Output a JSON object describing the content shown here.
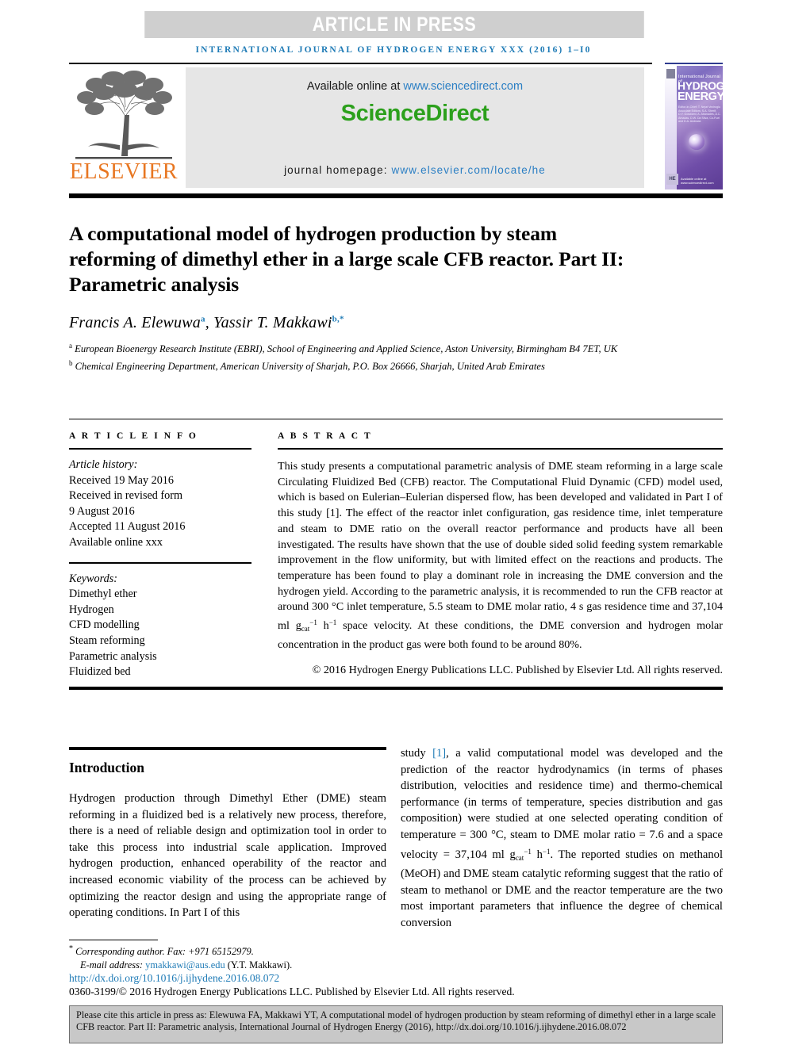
{
  "banner": {
    "text": "ARTICLE IN PRESS",
    "bg_color": "#cfcfcf",
    "text_color": "#ffffff"
  },
  "running_head": "INTERNATIONAL JOURNAL OF HYDROGEN ENERGY XXX (2016) 1–I0",
  "masthead": {
    "publisher": "ELSEVIER",
    "publisher_color": "#e87722",
    "available_prefix": "Available online at ",
    "available_url": "www.sciencedirect.com",
    "sciencedirect_logo": "ScienceDirect",
    "sciencedirect_color": "#2ca01c",
    "homepage_prefix": "journal homepage: ",
    "homepage_url": "www.elsevier.com/locate/he",
    "link_color": "#2b7fc4"
  },
  "cover": {
    "line_italic": "International Journal of",
    "line1": "HYDROGEN",
    "line2": "ENERGY",
    "editors": "Editor-in-Chief: T. Nejat Veziroglu\nAssociate Editors: S.A. Sherif, D.Y. Goswami, A. Abanades,\nA.C. Amadas, D.W. Da Silva,\nCo-Fuel and D.A. Andrada",
    "he_mark": "HE",
    "sd_mark": "Available online at www.sciencedirect.com"
  },
  "title": "A computational model of hydrogen production by steam reforming of dimethyl ether in a large scale CFB reactor. Part II: Parametric analysis",
  "authors": [
    {
      "name": "Francis A. Elewuwa",
      "marks": "a"
    },
    {
      "name": "Yassir T. Makkawi",
      "marks": "b,*"
    }
  ],
  "affiliations": [
    {
      "mark": "a",
      "text": "European Bioenergy Research Institute (EBRI), School of Engineering and Applied Science, Aston University, Birmingham B4 7ET, UK"
    },
    {
      "mark": "b",
      "text": "Chemical Engineering Department, American University of Sharjah, P.O. Box 26666, Sharjah, United Arab Emirates"
    }
  ],
  "article_info": {
    "heading": "A R T I C L E   I N F O",
    "history_label": "Article history:",
    "history": [
      "Received 19 May 2016",
      "Received in revised form",
      "9 August 2016",
      "Accepted 11 August 2016",
      "Available online xxx"
    ],
    "keywords_label": "Keywords:",
    "keywords": [
      "Dimethyl ether",
      "Hydrogen",
      "CFD modelling",
      "Steam reforming",
      "Parametric analysis",
      "Fluidized bed"
    ]
  },
  "abstract": {
    "heading": "A B S T R A C T",
    "part1": "This study presents a computational parametric analysis of DME steam reforming in a large scale Circulating Fluidized Bed (CFB) reactor. The Computational Fluid Dynamic (CFD) model used, which is based on Eulerian–Eulerian dispersed flow, has been developed and validated in Part I of this study [1]. The effect of the reactor inlet configuration, gas residence time, inlet temperature and steam to DME ratio on the overall reactor performance and products have all been investigated. The results have shown that the use of double sided solid feeding system remarkable improvement in the flow uniformity, but with limited effect on the reactions and products. The temperature has been found to play a dominant role in increasing the DME conversion and the hydrogen yield. According to the parametric analysis, it is recommended to run the CFB reactor at around 300 °C inlet temperature, 5.5 steam to DME molar ratio, 4 s gas residence time and 37,104 ml g",
    "unit_sub": "cat",
    "unit_sup": "−1",
    "part2": " h",
    "unit_sup2": "−1",
    "part3": " space velocity. At these conditions, the DME conversion and hydrogen molar concentration in the product gas were both found to be around 80%.",
    "copyright": "© 2016 Hydrogen Energy Publications LLC. Published by Elsevier Ltd. All rights reserved."
  },
  "body": {
    "intro_heading": "Introduction",
    "left_paragraph": "Hydrogen production through Dimethyl Ether (DME) steam reforming in a fluidized bed is a relatively new process, therefore, there is a need of reliable design and optimization tool in order to take this process into industrial scale application. Improved hydrogen production, enhanced operability of the reactor and increased economic viability of the process can be achieved by optimizing the reactor design and using the appropriate range of operating conditions. In Part I of this",
    "right_part1": "study ",
    "right_ref": "[1]",
    "right_part2": ", a valid computational model was developed and the prediction of the reactor hydrodynamics (in terms of phases distribution, velocities and residence time) and thermo-chemical performance (in terms of temperature, species distribution and gas composition) were studied at one selected operating condition of temperature = 300 °C, steam to DME molar ratio = 7.6 and a space velocity = 37,104 ml g",
    "right_sub": "cat",
    "right_sup": "−1",
    "right_part3": " h",
    "right_sup2": "−1",
    "right_part4": ". The reported studies on methanol (MeOH) and DME steam catalytic reforming suggest that the ratio of steam to methanol or DME and the reactor temperature are the two most important parameters that influence the degree of chemical conversion"
  },
  "footnote": {
    "corresponding": "Corresponding author. Fax: +971 65152979.",
    "email_label": "E-mail address: ",
    "email": "ymakkawi@aus.edu",
    "email_suffix": " (Y.T. Makkawi).",
    "doi": "http://dx.doi.org/10.1016/j.ijhydene.2016.08.072",
    "issn": "0360-3199/© 2016 Hydrogen Energy Publications LLC. Published by Elsevier Ltd. All rights reserved."
  },
  "cite_box": {
    "text": "Please cite this article in press as: Elewuwa FA, Makkawi YT, A computational model of hydrogen production by steam reforming of dimethyl ether in a large scale CFB reactor. Part II: Parametric analysis, International Journal of Hydrogen Energy (2016), http://dx.doi.org/10.1016/j.ijhydene.2016.08.072"
  }
}
